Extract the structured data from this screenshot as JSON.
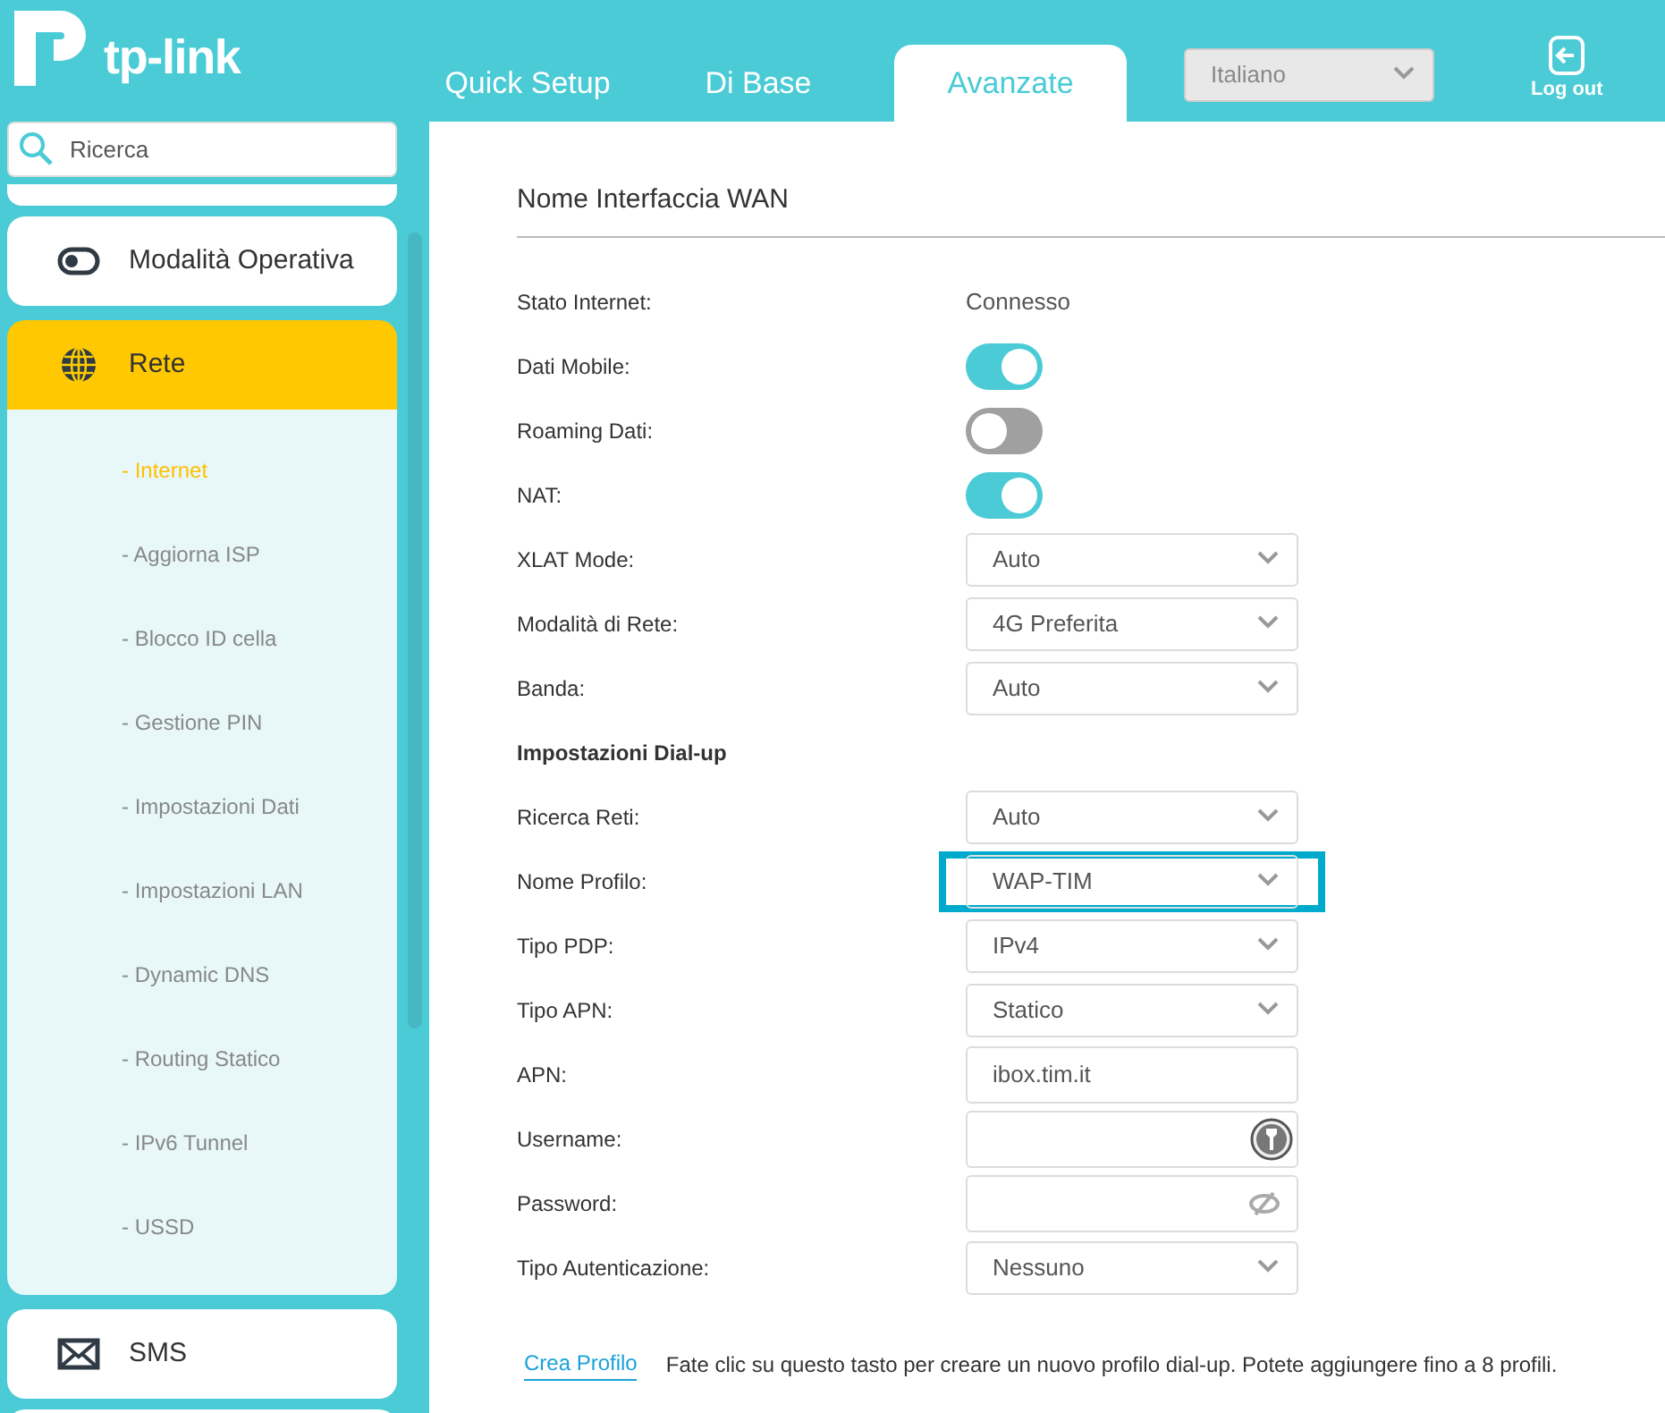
{
  "logo": {
    "text": "tp-link"
  },
  "tabs": [
    {
      "label": "Quick Setup",
      "selected": false
    },
    {
      "label": "Di Base",
      "selected": false
    },
    {
      "label": "Avanzate",
      "selected": true
    }
  ],
  "language": {
    "value": "Italiano"
  },
  "logout": {
    "label": "Log out"
  },
  "search": {
    "placeholder": "Ricerca"
  },
  "sidebar": {
    "items": [
      {
        "label": "Modalità Operativa",
        "selected": false
      },
      {
        "label": "Rete",
        "selected": true,
        "children": [
          {
            "label": "- Internet",
            "selected": true
          },
          {
            "label": "- Aggiorna ISP",
            "selected": false
          },
          {
            "label": "- Blocco ID cella",
            "selected": false
          },
          {
            "label": "- Gestione PIN",
            "selected": false
          },
          {
            "label": "- Impostazioni Dati",
            "selected": false
          },
          {
            "label": "- Impostazioni LAN",
            "selected": false
          },
          {
            "label": "- Dynamic DNS",
            "selected": false
          },
          {
            "label": "- Routing Statico",
            "selected": false
          },
          {
            "label": "- IPv6 Tunnel",
            "selected": false
          },
          {
            "label": "- USSD",
            "selected": false
          }
        ]
      },
      {
        "label": "SMS",
        "selected": false
      }
    ]
  },
  "section_title": "Nome Interfaccia WAN",
  "rows": [
    {
      "kind": "text",
      "label": "Stato Internet:",
      "value": "Connesso"
    },
    {
      "kind": "toggle",
      "label": "Dati Mobile:",
      "on": true
    },
    {
      "kind": "toggle",
      "label": "Roaming Dati:",
      "on": false
    },
    {
      "kind": "toggle",
      "label": "NAT:",
      "on": true
    },
    {
      "kind": "select",
      "label": "XLAT Mode:",
      "value": "Auto",
      "highlighted": false
    },
    {
      "kind": "select",
      "label": "Modalità di Rete:",
      "value": "4G Preferita",
      "highlighted": false
    },
    {
      "kind": "select",
      "label": "Banda:",
      "value": "Auto",
      "highlighted": false
    },
    {
      "kind": "heading",
      "label": "Impostazioni Dial-up"
    },
    {
      "kind": "select",
      "label": "Ricerca Reti:",
      "value": "Auto",
      "highlighted": false
    },
    {
      "kind": "select",
      "label": "Nome Profilo:",
      "value": "WAP-TIM",
      "highlighted": true
    },
    {
      "kind": "select",
      "label": "Tipo PDP:",
      "value": "IPv4",
      "highlighted": false
    },
    {
      "kind": "select",
      "label": "Tipo APN:",
      "value": "Statico",
      "highlighted": false
    },
    {
      "kind": "input",
      "label": "APN:",
      "value": "ibox.tim.it"
    },
    {
      "kind": "username_input",
      "label": "Username:",
      "value": ""
    },
    {
      "kind": "password_input",
      "label": "Password:",
      "value": ""
    },
    {
      "kind": "select",
      "label": "Tipo Autenticazione:",
      "value": "Nessuno",
      "highlighted": false
    }
  ],
  "footer": {
    "link": "Crea Profilo",
    "note": "Fate clic su questo tasto per creare un nuovo profilo dial-up. Potete aggiungere fino a 8 profili."
  }
}
